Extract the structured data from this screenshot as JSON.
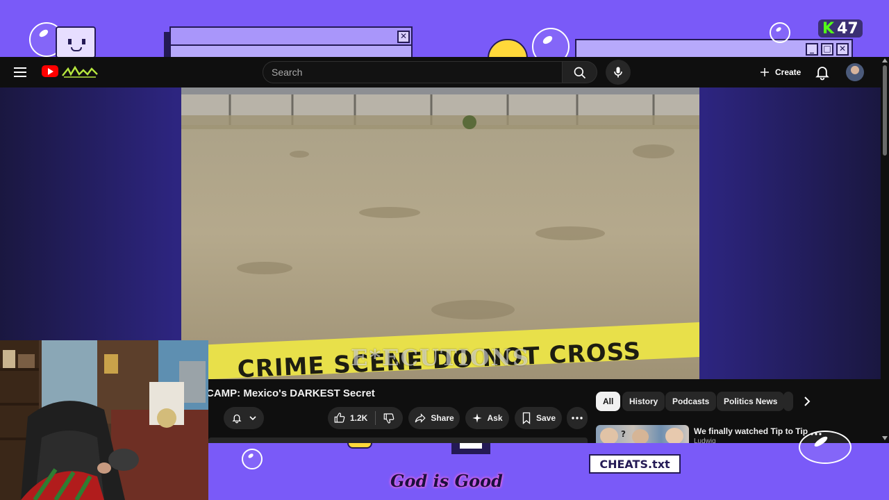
{
  "overlay": {
    "k47_k": "K",
    "k47_num": "47",
    "footer_text": "God is Good",
    "cheats_label": "CHEATS.txt",
    "window_close_glyph": "✕",
    "window_min_glyph": "_",
    "window_max_glyph": "□"
  },
  "header": {
    "search_placeholder": "Search",
    "create_label": "Create"
  },
  "video": {
    "overlay_text": "E*ECUTIONS",
    "tape_text": "CRIME SCENE DO NOT CROSS",
    "title": "CAMP: Mexico's DARKEST Secret",
    "like_count": "1.2K",
    "share_label": "Share",
    "ask_label": "Ask",
    "save_label": "Save"
  },
  "chips": [
    "All",
    "History",
    "Podcasts",
    "Politics News"
  ],
  "recommendation": {
    "title": "We finally watched Tip to Tip",
    "channel": "Ludwig"
  },
  "colors": {
    "overlay_purple": "#7a5af8",
    "youtube_red": "#ff0000",
    "kick_green": "#53fc18",
    "tape_yellow": "#e8e04a"
  },
  "icons": [
    "menu-icon",
    "youtube-logo-icon",
    "search-icon",
    "mic-icon",
    "plus-icon",
    "bell-icon",
    "like-icon",
    "dislike-icon",
    "share-icon",
    "sparkle-icon",
    "bookmark-icon",
    "more-icon",
    "chevron-right-icon"
  ]
}
